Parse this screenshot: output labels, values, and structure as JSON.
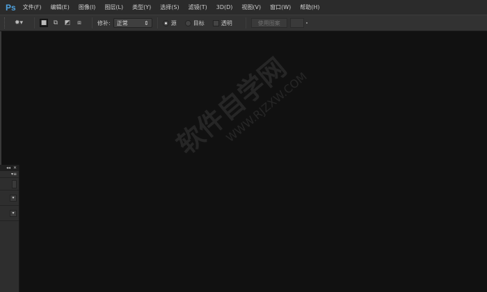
{
  "app": {
    "logo": "Ps"
  },
  "menu": [
    "文件(F)",
    "编辑(E)",
    "图像(I)",
    "图层(L)",
    "类型(Y)",
    "选择(S)",
    "滤镜(T)",
    "3D(D)",
    "视图(V)",
    "窗口(W)",
    "帮助(H)"
  ],
  "options": {
    "patch_label": "修补:",
    "patch_mode": "正常",
    "source_label": "源",
    "target_label": "目标",
    "transparent_label": "透明",
    "use_pattern_label": "使用图案"
  },
  "panel": {
    "collapse": "◂◂",
    "close": "✕",
    "menu": "▾≡"
  },
  "watermark": {
    "text": "软件自学网",
    "url": "WWW.RJZXW.COM"
  }
}
